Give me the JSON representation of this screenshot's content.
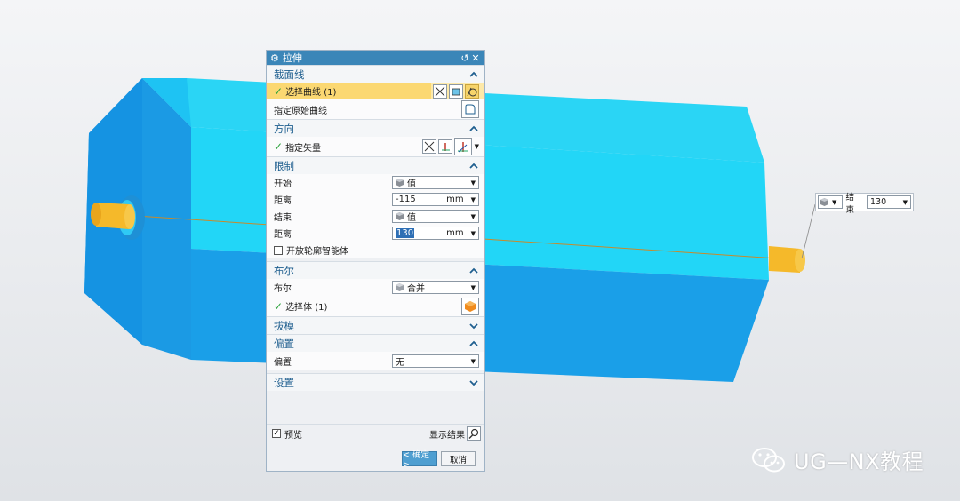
{
  "dialog": {
    "title": "拉伸",
    "sections": {
      "section_curve": {
        "title": "截面线",
        "select_curve": "选择曲线 (1)",
        "specify_origin_curve": "指定原始曲线"
      },
      "direction": {
        "title": "方向",
        "specify_vector": "指定矢量"
      },
      "limits": {
        "title": "限制",
        "start_label": "开始",
        "start_value": "值",
        "distance1_label": "距离",
        "distance1_value": "-115",
        "distance1_unit": "mm",
        "end_label": "结束",
        "end_value": "值",
        "distance2_label": "距离",
        "distance2_value": "130",
        "distance2_unit": "mm",
        "open_profile_label": "开放轮廓智能体"
      },
      "boolean": {
        "title": "布尔",
        "boolean_label": "布尔",
        "boolean_value": "合并",
        "select_body": "选择体 (1)"
      },
      "draft": {
        "title": "拔模"
      },
      "offset": {
        "title": "偏置",
        "offset_label": "偏置",
        "offset_value": "无"
      },
      "settings": {
        "title": "设置"
      }
    },
    "preview_label": "预览",
    "show_result_label": "显示结果",
    "ok_label": "< 确定 >",
    "cancel_label": "取消"
  },
  "float_input": {
    "end_label": "结束",
    "end_value": "130"
  },
  "watermark": {
    "text": "UG—NX教程"
  },
  "colors": {
    "accent": "#3b86b8",
    "highlight": "#fbd872",
    "body_top": "#2ad8f5",
    "body_side": "#1aa7ea",
    "pin": "#f5b92a"
  }
}
